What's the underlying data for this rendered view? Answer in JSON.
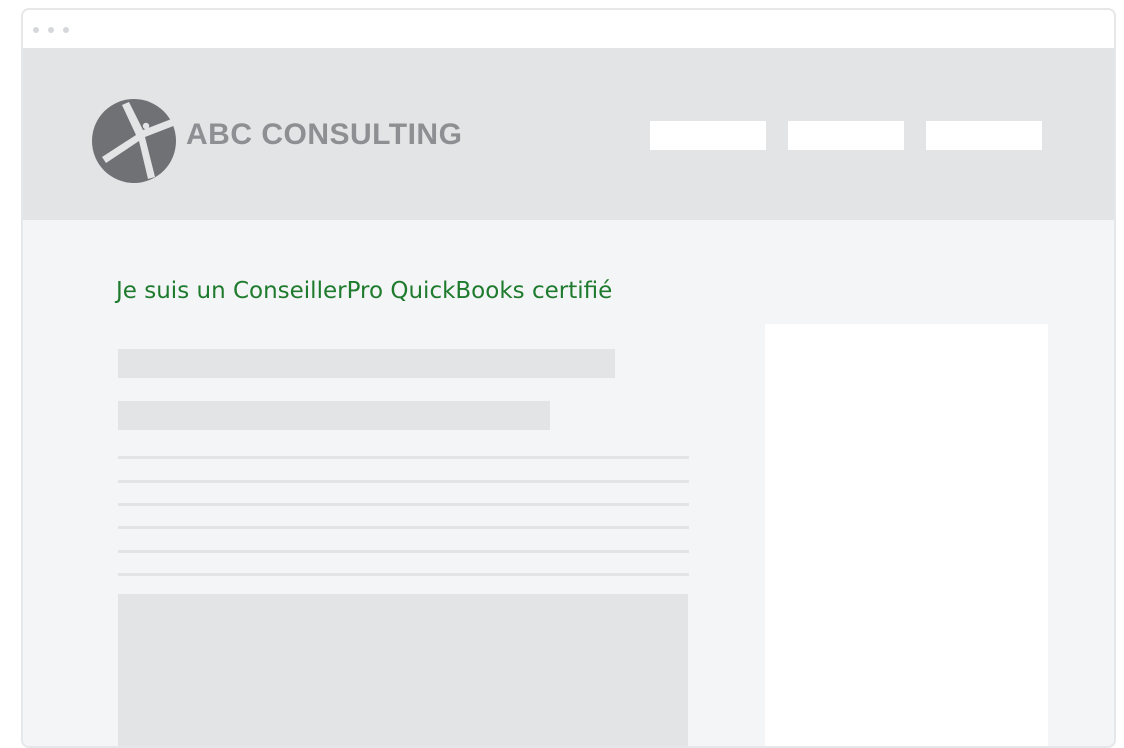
{
  "header": {
    "company_name": "ABC CONSULTING",
    "logo_icon": "abc-consulting-logo-icon",
    "nav_items": [
      "",
      "",
      ""
    ]
  },
  "main": {
    "headline": "Je suis un ConseillerPro QuickBooks certifié"
  },
  "colors": {
    "headline": "#1e7b2d",
    "header_bg": "#e3e4e6",
    "page_bg": "#f4f5f7",
    "logo": "#6f7175",
    "company_name": "#8d8f93"
  }
}
